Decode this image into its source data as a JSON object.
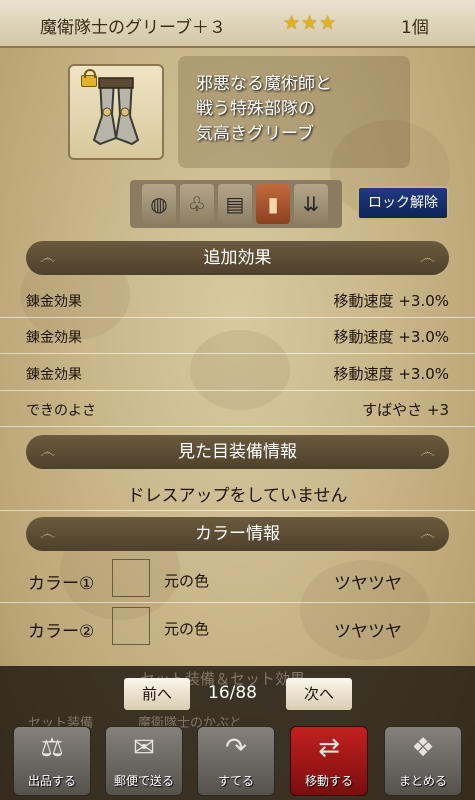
{
  "header": {
    "title": "魔衛隊士のグリーブ＋３",
    "stars": "★★★",
    "count": "1個"
  },
  "item": {
    "icon": "greaves-icon",
    "description": "邪悪なる魔術師と\n戦う特殊部隊の\n気高きグリーブ"
  },
  "icon_bar": {
    "icons": [
      "bag-icon",
      "clover-icon",
      "storage-icon",
      "book-icon",
      "arrows-down-icon"
    ],
    "lock_release": "ロック解除"
  },
  "additional_effects": {
    "title": "追加効果",
    "rows": [
      {
        "label": "錬金効果",
        "value": "移動速度 +3.0%"
      },
      {
        "label": "錬金効果",
        "value": "移動速度 +3.0%"
      },
      {
        "label": "錬金効果",
        "value": "移動速度 +3.0%"
      },
      {
        "label": "できのよさ",
        "value": "すばやさ +3"
      }
    ]
  },
  "appearance": {
    "title": "見た目装備情報",
    "status": "ドレスアップをしていません"
  },
  "color_info": {
    "title": "カラー情報",
    "rows": [
      {
        "label": "カラー①",
        "original": "元の色",
        "texture": "ツヤツヤ"
      },
      {
        "label": "カラー②",
        "original": "元の色",
        "texture": "ツヤツヤ"
      }
    ]
  },
  "set_info": {
    "title": "セット装備＆セット効果",
    "label": "セット装備",
    "value": "魔衛隊士のかぶと"
  },
  "pager": {
    "prev": "前へ",
    "page": "16/88",
    "next": "次へ"
  },
  "bottom_buttons": [
    {
      "label": "出品する",
      "icon": "scales-icon"
    },
    {
      "label": "郵便で送る",
      "icon": "mail-icon"
    },
    {
      "label": "すてる",
      "icon": "discard-icon"
    },
    {
      "label": "移動する",
      "icon": "move-icon"
    },
    {
      "label": "まとめる",
      "icon": "bundle-icon"
    }
  ]
}
